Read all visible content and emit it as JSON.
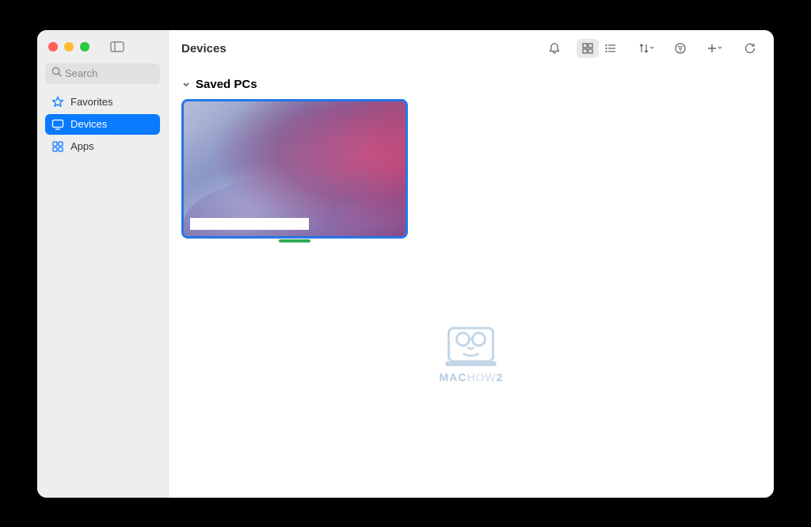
{
  "header": {
    "title": "Devices"
  },
  "search": {
    "placeholder": "Search",
    "value": ""
  },
  "sidebar": {
    "items": [
      {
        "label": "Favorites",
        "icon": "star-icon",
        "active": false
      },
      {
        "label": "Devices",
        "icon": "display-icon",
        "active": true
      },
      {
        "label": "Apps",
        "icon": "apps-icon",
        "active": false
      }
    ]
  },
  "section": {
    "title": "Saved PCs",
    "expanded": true
  },
  "toolbar": {
    "view": "grid"
  },
  "watermark": {
    "brand_a": "MAC",
    "brand_b": "HOW",
    "brand_c": "2"
  },
  "colors": {
    "accent": "#0a7aff",
    "selection": "#2576e8",
    "status_online": "#34a853",
    "sidebar_bg": "#eeeeef"
  }
}
